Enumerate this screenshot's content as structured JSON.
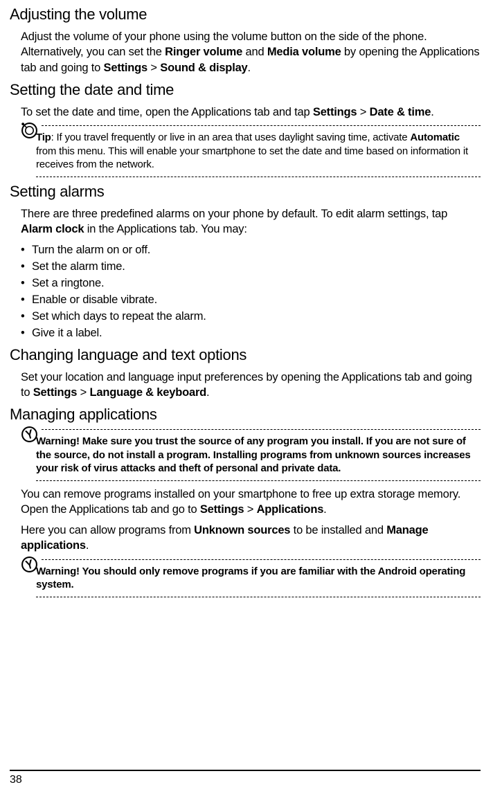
{
  "section1": {
    "heading": "Adjusting the volume",
    "p1_a": "Adjust the volume of your phone using the volume button on the side of the phone. Alternatively, you can set the ",
    "p1_b1": "Ringer volume",
    "p1_c": " and ",
    "p1_b2": "Media volume",
    "p1_d": " by opening the Applications tab and going to ",
    "p1_b3": "Settings",
    "p1_e": " > ",
    "p1_b4": "Sound & display",
    "p1_f": "."
  },
  "section2": {
    "heading": "Setting the date and time",
    "p1_a": "To set the date and time, open the Applications tab and tap ",
    "p1_b1": "Settings",
    "p1_c": " > ",
    "p1_b2": "Date & time",
    "p1_d": ".",
    "tip_label": "Tip",
    "tip_a": ": If you travel frequently or live in an area that uses daylight saving time, activate ",
    "tip_b": "Automatic",
    "tip_c": " from this menu. This will enable your smartphone to set the date and time based on information it receives from the network."
  },
  "section3": {
    "heading": "Setting alarms",
    "p1_a": "There are three predefined alarms on your phone by default. To edit alarm settings, tap ",
    "p1_b": "Alarm clock",
    "p1_c": " in the Applications tab. You may:",
    "li1": "Turn the alarm on or off.",
    "li2": "Set the alarm time.",
    "li3": "Set a ringtone.",
    "li4": "Enable or disable vibrate.",
    "li5": "Set which days to repeat the alarm.",
    "li6": "Give it a label."
  },
  "section4": {
    "heading": "Changing language and text options",
    "p1_a": "Set your location and language input preferences by opening the Applications tab and going to ",
    "p1_b1": "Settings",
    "p1_c": " > ",
    "p1_b2": "Language & keyboard",
    "p1_d": "."
  },
  "section5": {
    "heading": "Managing applications",
    "warn1": "Warning! Make sure you trust the source of any program you install. If you are not sure of the source, do not install a program. Installing programs from unknown sources increases your risk of virus attacks and theft of personal and private data.",
    "p1_a": "You can remove programs installed on your smartphone to free up extra storage memory. Open the Applications tab and go to ",
    "p1_b1": "Settings",
    "p1_c": " > ",
    "p1_b2": "Applications",
    "p1_d": ".",
    "p2_a": "Here you can allow programs from ",
    "p2_b1": "Unknown sources",
    "p2_c": " to be installed and ",
    "p2_b2": "Manage applications",
    "p2_d": ".",
    "warn2": "Warning! You should only remove programs if you are familiar with the Android operating system."
  },
  "page_number": "38"
}
